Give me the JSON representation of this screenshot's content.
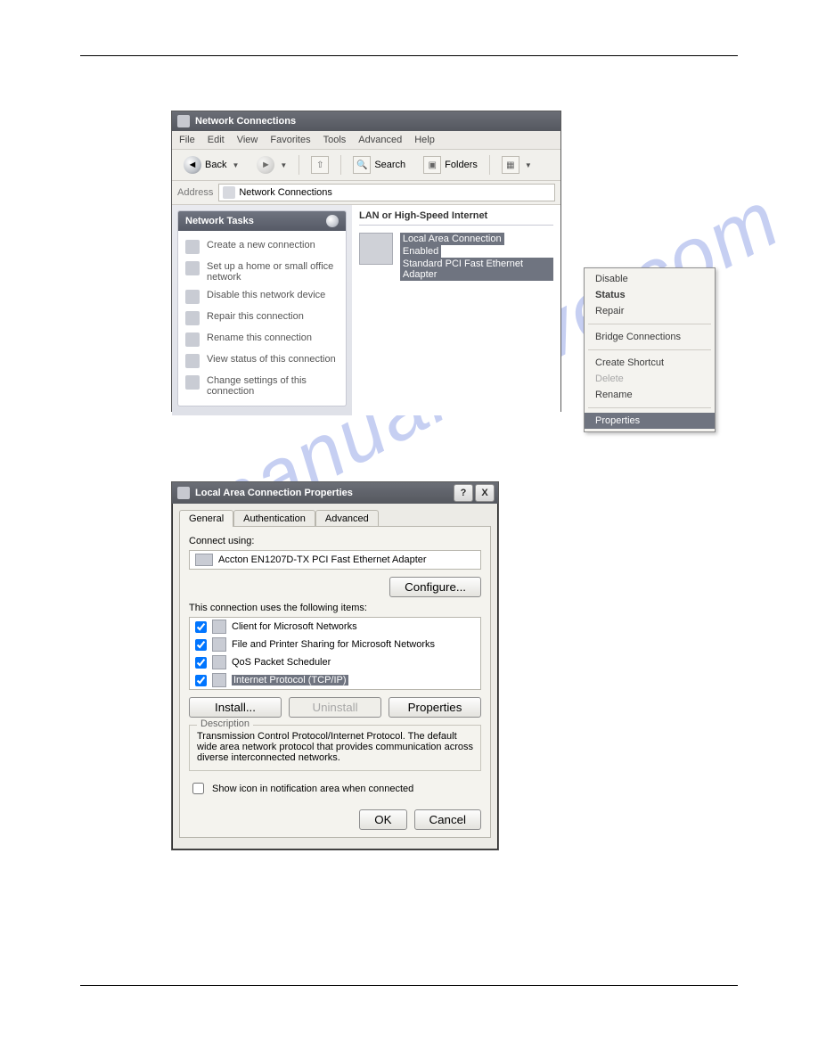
{
  "watermark": "manualshive.com",
  "win1": {
    "title": "Network Connections",
    "menu": {
      "file": "File",
      "edit": "Edit",
      "view": "View",
      "favorites": "Favorites",
      "tools": "Tools",
      "advanced": "Advanced",
      "help": "Help"
    },
    "toolbar": {
      "back": "Back",
      "search": "Search",
      "folders": "Folders"
    },
    "address": {
      "label": "Address",
      "value": "Network Connections"
    },
    "sidebar": {
      "heading": "Network Tasks",
      "tasks": [
        "Create a new connection",
        "Set up a home or small office network",
        "Disable this network device",
        "Repair this connection",
        "Rename this connection",
        "View status of this connection",
        "Change settings of this connection"
      ]
    },
    "main": {
      "section": "LAN or High-Speed Internet",
      "conn_name": "Local Area Connection",
      "conn_status": "Enabled",
      "conn_device": "Standard PCI Fast Ethernet Adapter"
    },
    "context": {
      "disable": "Disable",
      "status": "Status",
      "repair": "Repair",
      "bridge": "Bridge Connections",
      "shortcut": "Create Shortcut",
      "delete": "Delete",
      "rename": "Rename",
      "properties": "Properties"
    }
  },
  "win2": {
    "title": "Local Area Connection Properties",
    "help": "?",
    "close": "X",
    "tabs": {
      "general": "General",
      "auth": "Authentication",
      "advanced": "Advanced"
    },
    "connect_using": "Connect using:",
    "adapter": "Accton EN1207D-TX PCI Fast Ethernet Adapter",
    "configure": "Configure...",
    "uses": "This connection uses the following items:",
    "items": [
      "Client for Microsoft Networks",
      "File and Printer Sharing for Microsoft Networks",
      "QoS Packet Scheduler",
      "Internet Protocol (TCP/IP)"
    ],
    "install": "Install...",
    "uninstall": "Uninstall",
    "properties": "Properties",
    "desc_label": "Description",
    "desc": "Transmission Control Protocol/Internet Protocol. The default wide area network protocol that provides communication across diverse interconnected networks.",
    "showicon": "Show icon in notification area when connected",
    "ok": "OK",
    "cancel": "Cancel"
  }
}
